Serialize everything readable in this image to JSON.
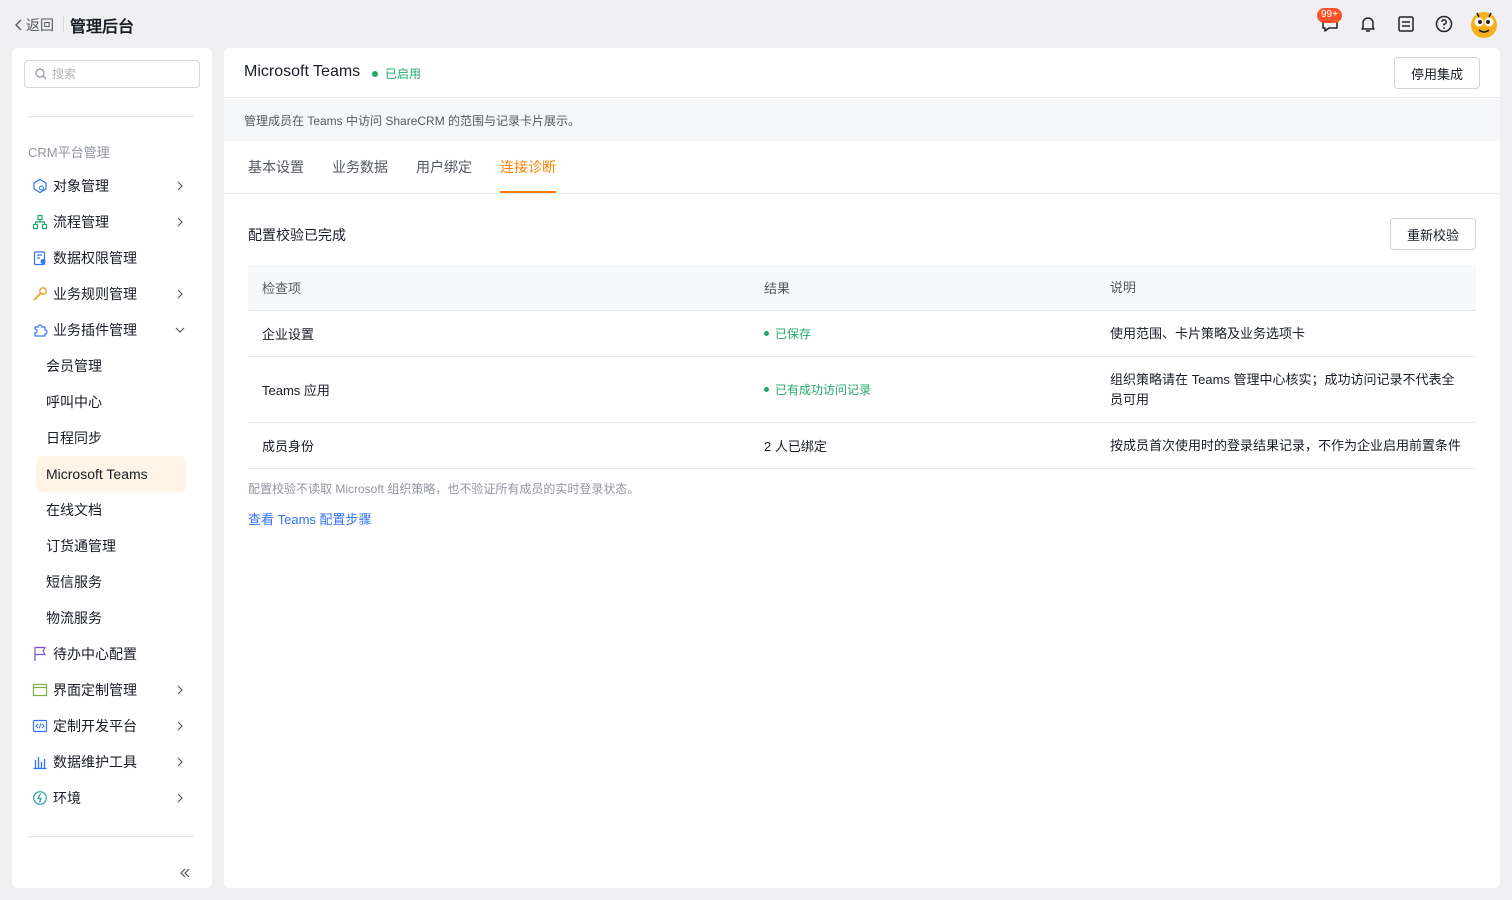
{
  "topbar": {
    "back_label": "返回",
    "app_title": "管理后台",
    "message_badge": "99+",
    "icons": [
      "message-icon",
      "bell-icon",
      "todo-icon",
      "help-icon",
      "avatar"
    ]
  },
  "sidebar": {
    "search_placeholder": "搜索",
    "section_label": "CRM平台管理",
    "items": [
      {
        "label": "对象管理",
        "icon": "object-icon",
        "expandable": true
      },
      {
        "label": "流程管理",
        "icon": "flow-icon",
        "expandable": true
      },
      {
        "label": "数据权限管理",
        "icon": "permission-icon",
        "expandable": false
      },
      {
        "label": "业务规则管理",
        "icon": "rule-icon",
        "expandable": true
      },
      {
        "label": "业务插件管理",
        "icon": "plugin-icon",
        "expanded": true
      },
      {
        "label": "待办中心配置",
        "icon": "flag-icon",
        "expandable": false
      },
      {
        "label": "界面定制管理",
        "icon": "layout-icon",
        "expandable": true
      },
      {
        "label": "定制开发平台",
        "icon": "code-icon",
        "expandable": true
      },
      {
        "label": "数据维护工具",
        "icon": "chart-icon",
        "expandable": true
      },
      {
        "label": "环境",
        "icon": "env-icon",
        "expandable": true
      }
    ],
    "plugin_children": [
      "会员管理",
      "呼叫中心",
      "日程同步",
      "Microsoft Teams",
      "在线文档",
      "订货通管理",
      "短信服务",
      "物流服务"
    ],
    "active_child": "Microsoft Teams"
  },
  "header": {
    "title": "Microsoft Teams",
    "status": "已启用",
    "disable_button": "停用集成"
  },
  "description": "管理成员在 Teams 中访问 ShareCRM 的范围与记录卡片展示。",
  "tabs": [
    "基本设置",
    "业务数据",
    "用户绑定",
    "连接诊断"
  ],
  "active_tab": "连接诊断",
  "diagnosis": {
    "title": "配置校验已完成",
    "recheck_button": "重新校验",
    "columns": [
      "检查项",
      "结果",
      "说明"
    ],
    "rows": [
      {
        "item": "企业设置",
        "result": "已保存",
        "result_ok": true,
        "desc": "使用范围、卡片策略及业务选项卡"
      },
      {
        "item": "Teams 应用",
        "result": "已有成功访问记录",
        "result_ok": true,
        "desc": "组织策略请在 Teams 管理中心核实；成功访问记录不代表全员可用"
      },
      {
        "item": "成员身份",
        "result": "2 人已绑定",
        "result_ok": false,
        "desc": "按成员首次使用时的登录结果记录，不作为企业启用前置条件"
      }
    ],
    "note": "配置校验不读取 Microsoft 组织策略，也不验证所有成员的实时登录状态。",
    "link": "查看 Teams 配置步骤"
  },
  "colors": {
    "accent": "#ff8000",
    "success": "#22a86b",
    "link": "#3373f5",
    "active_bg": "#fff4e5"
  }
}
